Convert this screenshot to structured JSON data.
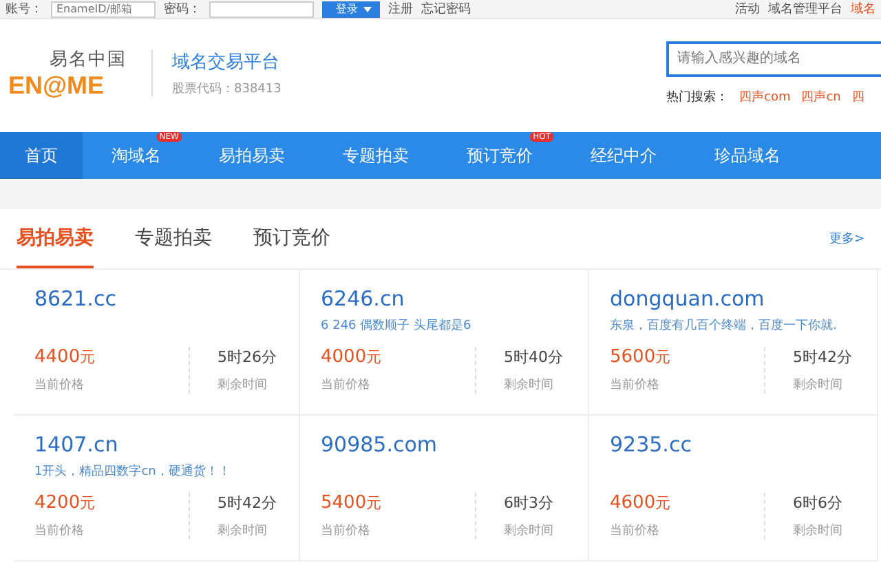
{
  "top_bar": {
    "account_label": "账号：",
    "account_placeholder": "EnameID/邮箱",
    "password_label": "密码：",
    "login": "登录",
    "register": "注册",
    "forgot": "忘记密码",
    "links": [
      "活动",
      "域名管理平台",
      "域名"
    ]
  },
  "header": {
    "logo_cn": "易名中国",
    "logo_en": "EN@ME",
    "platform": "域名交易平台",
    "stock": "股票代码：838413",
    "search": {
      "placeholder": "请输入感兴趣的域名"
    },
    "hot_label": "热门搜索：",
    "hot": [
      "四声com",
      "四声cn",
      "四"
    ]
  },
  "nav": [
    {
      "label": "首页",
      "selected": true
    },
    {
      "label": "淘域名",
      "selected": false,
      "badge": "NEW"
    },
    {
      "label": "易拍易卖",
      "selected": false
    },
    {
      "label": "专题拍卖",
      "selected": false
    },
    {
      "label": "预订竞价",
      "selected": false,
      "badge": "HOT"
    },
    {
      "label": "经纪中介",
      "selected": false
    },
    {
      "label": "珍品域名",
      "selected": false
    }
  ],
  "tabs": [
    {
      "label": "易拍易卖",
      "selected": true
    },
    {
      "label": "专题拍卖",
      "selected": false
    },
    {
      "label": "预订竞价",
      "selected": false
    }
  ],
  "more": "更多>",
  "cards": [
    {
      "domain": "8621.cc",
      "price": "4400",
      "unit": "元",
      "price_label": "当前价格",
      "time": "5时26分",
      "time_label": "剩余时间"
    },
    {
      "domain": "6246.cn",
      "desc": "6 246 偶数顺子 头尾都是6",
      "price": "4000",
      "unit": "元",
      "price_label": "当前价格",
      "time": "5时40分",
      "time_label": "剩余时间"
    },
    {
      "domain": "dongquan.com",
      "desc": "东泉，百度有几百个终端，百度一下你就.",
      "price": "5600",
      "unit": "元",
      "price_label": "当前价格",
      "time": "5时42分",
      "time_label": "剩余时间"
    },
    {
      "domain": "1407.cn",
      "desc": "1开头，精品四数字cn，硬通货！！",
      "price": "4200",
      "unit": "元",
      "price_label": "当前价格",
      "time": "5时42分",
      "time_label": "剩余时间"
    },
    {
      "domain": "90985.com",
      "price": "5400",
      "unit": "元",
      "price_label": "当前价格",
      "time": "6时3分",
      "time_label": "剩余时间"
    },
    {
      "domain": "9235.cc",
      "price": "4600",
      "unit": "元",
      "price_label": "当前价格",
      "time": "6时6分",
      "time_label": "剩余时间"
    }
  ]
}
